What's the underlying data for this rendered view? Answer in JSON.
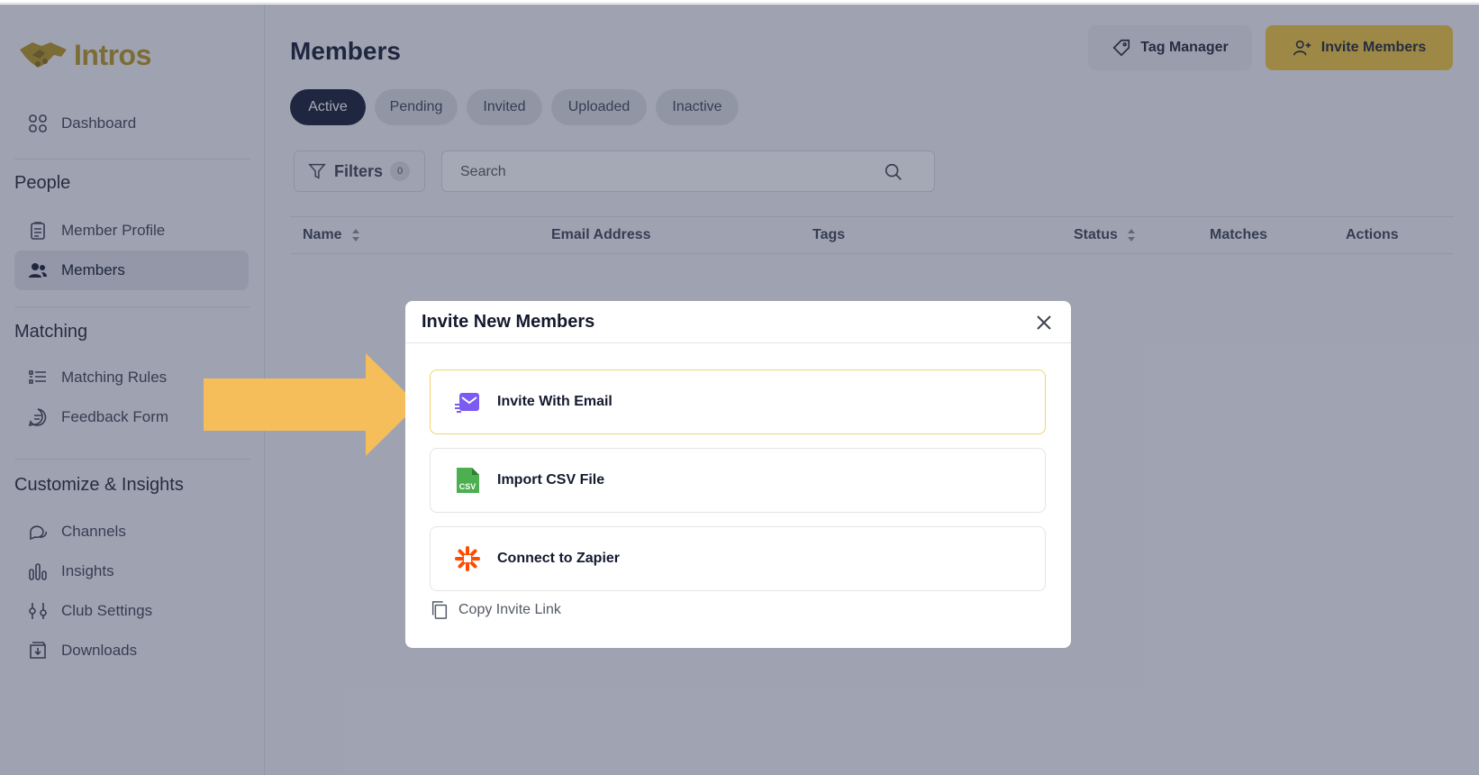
{
  "app": {
    "name": "Intros"
  },
  "sidebar": {
    "dashboard": "Dashboard",
    "sections": [
      {
        "title": "People",
        "items": [
          {
            "label": "Member Profile"
          },
          {
            "label": "Members",
            "active": true
          }
        ]
      },
      {
        "title": "Matching",
        "items": [
          {
            "label": "Matching Rules"
          },
          {
            "label": "Feedback Form"
          }
        ]
      },
      {
        "title": "Customize & Insights",
        "items": [
          {
            "label": "Channels"
          },
          {
            "label": "Insights"
          },
          {
            "label": "Club Settings"
          },
          {
            "label": "Downloads"
          }
        ]
      }
    ]
  },
  "header": {
    "title": "Members",
    "tag_manager_label": "Tag Manager",
    "invite_members_label": "Invite Members"
  },
  "tabs": [
    {
      "label": "Active",
      "active": true
    },
    {
      "label": "Pending"
    },
    {
      "label": "Invited"
    },
    {
      "label": "Uploaded"
    },
    {
      "label": "Inactive"
    }
  ],
  "filters": {
    "label": "Filters",
    "count": "0"
  },
  "search": {
    "placeholder": "Search"
  },
  "table": {
    "columns": [
      "Name",
      "Email Address",
      "Tags",
      "Status",
      "Matches",
      "Actions"
    ]
  },
  "modal": {
    "title": "Invite New Members",
    "options": [
      {
        "label": "Invite With Email",
        "icon": "email-icon"
      },
      {
        "label": "Import CSV File",
        "icon": "csv-file-icon"
      },
      {
        "label": "Connect to Zapier",
        "icon": "zapier-icon"
      }
    ],
    "copy_link_label": "Copy Invite Link"
  },
  "colors": {
    "accent": "#f2c63a",
    "brand_logo": "#b8941f",
    "primary_dark": "#141a2e",
    "arrow": "#f5be5b",
    "email_icon": "#7c5cf0",
    "csv_icon": "#4caf50",
    "zapier_icon": "#ff4a00"
  }
}
